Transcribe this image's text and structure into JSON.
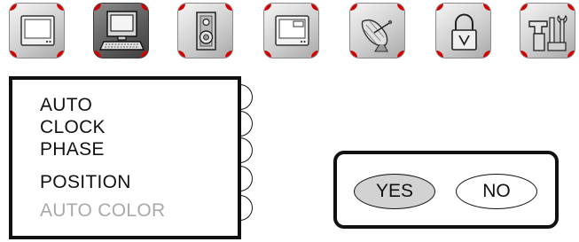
{
  "tabs": [
    {
      "name": "picture",
      "icon": "monitor-icon",
      "active": false
    },
    {
      "name": "geometry",
      "icon": "computer-icon",
      "active": true
    },
    {
      "name": "audio",
      "icon": "speaker-icon",
      "active": false
    },
    {
      "name": "display",
      "icon": "screen-window-icon",
      "active": false
    },
    {
      "name": "broadcast",
      "icon": "satellite-dish-icon",
      "active": false
    },
    {
      "name": "lock",
      "icon": "padlock-icon",
      "active": false
    },
    {
      "name": "setup",
      "icon": "tools-icon",
      "active": false
    }
  ],
  "menu": {
    "items": [
      {
        "label": "AUTO",
        "enabled": true
      },
      {
        "label": "CLOCK",
        "enabled": true
      },
      {
        "label": "PHASE",
        "enabled": true
      },
      {
        "label": "POSITION",
        "enabled": true
      },
      {
        "label": "AUTO COLOR",
        "enabled": false
      }
    ]
  },
  "dialog": {
    "yes_label": "YES",
    "no_label": "NO",
    "selected": "YES"
  },
  "colors": {
    "tab_corner_accent": "#d40000",
    "selected_button": "#d2d2d2",
    "disabled_text": "#a9a9a9",
    "border": "#111111"
  }
}
